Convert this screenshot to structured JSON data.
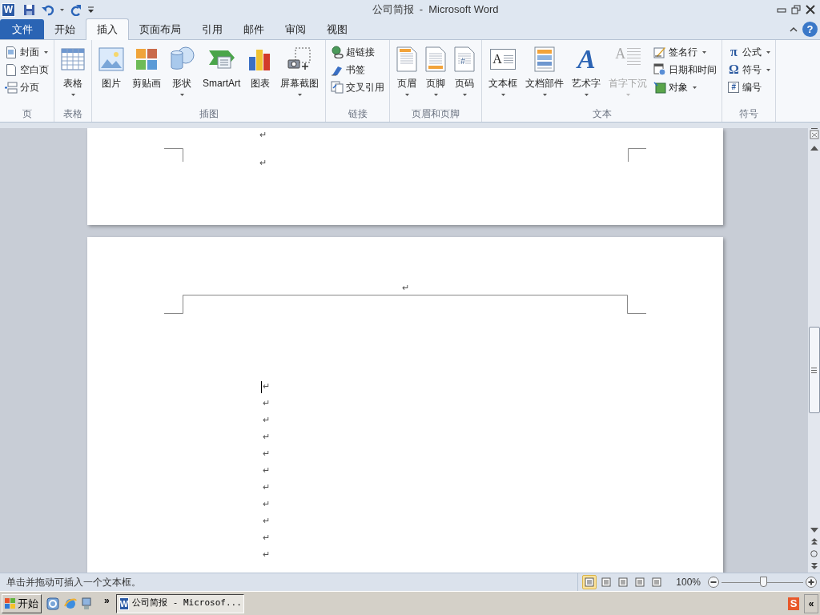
{
  "title_bar": {
    "logo": "W",
    "title": "公司简报  -  Microsoft Word"
  },
  "tabs": [
    {
      "label": "文件",
      "kind": "file",
      "selected": false
    },
    {
      "label": "开始",
      "kind": "tab",
      "selected": false
    },
    {
      "label": "插入",
      "kind": "tab",
      "selected": true
    },
    {
      "label": "页面布局",
      "kind": "tab",
      "selected": false
    },
    {
      "label": "引用",
      "kind": "tab",
      "selected": false
    },
    {
      "label": "邮件",
      "kind": "tab",
      "selected": false
    },
    {
      "label": "审阅",
      "kind": "tab",
      "selected": false
    },
    {
      "label": "视图",
      "kind": "tab",
      "selected": false
    }
  ],
  "help": "?",
  "ribbon": {
    "groups": [
      {
        "label": "页",
        "items": [
          {
            "label": "封面",
            "kind": "small",
            "dropdown": true,
            "disabled": false
          },
          {
            "label": "空白页",
            "kind": "small",
            "dropdown": false,
            "disabled": false
          },
          {
            "label": "分页",
            "kind": "small",
            "dropdown": false,
            "disabled": false
          }
        ]
      },
      {
        "label": "表格",
        "items": [
          {
            "label": "表格",
            "kind": "large",
            "dropdown": true,
            "disabled": false
          }
        ]
      },
      {
        "label": "插图",
        "items": [
          {
            "label": "图片",
            "kind": "large",
            "dropdown": false,
            "disabled": false
          },
          {
            "label": "剪贴画",
            "kind": "large",
            "dropdown": false,
            "disabled": false
          },
          {
            "label": "形状",
            "kind": "large",
            "dropdown": true,
            "disabled": false
          },
          {
            "label": "SmartArt",
            "kind": "large",
            "dropdown": false,
            "disabled": false
          },
          {
            "label": "图表",
            "kind": "large",
            "dropdown": false,
            "disabled": false
          },
          {
            "label": "屏幕截图",
            "kind": "large",
            "dropdown": true,
            "disabled": false
          }
        ]
      },
      {
        "label": "链接",
        "items": [
          {
            "label": "超链接",
            "kind": "small",
            "dropdown": false,
            "disabled": false
          },
          {
            "label": "书签",
            "kind": "small",
            "dropdown": false,
            "disabled": false
          },
          {
            "label": "交叉引用",
            "kind": "small",
            "dropdown": false,
            "disabled": false
          }
        ]
      },
      {
        "label": "页眉和页脚",
        "items": [
          {
            "label": "页眉",
            "kind": "large",
            "dropdown": true,
            "disabled": false
          },
          {
            "label": "页脚",
            "kind": "large",
            "dropdown": true,
            "disabled": false
          },
          {
            "label": "页码",
            "kind": "large",
            "dropdown": true,
            "disabled": false,
            "glyph": "#"
          }
        ]
      },
      {
        "label": "文本",
        "items": [
          {
            "label": "文本框",
            "kind": "large",
            "dropdown": true,
            "disabled": false,
            "glyph": "A"
          },
          {
            "label": "文档部件",
            "kind": "large",
            "dropdown": true,
            "disabled": false
          },
          {
            "label": "艺术字",
            "kind": "large",
            "dropdown": true,
            "disabled": false,
            "glyph": "A"
          },
          {
            "label": "首字下沉",
            "kind": "large",
            "dropdown": true,
            "disabled": true,
            "glyph": "A"
          },
          {
            "label": "签名行",
            "kind": "small",
            "dropdown": true,
            "disabled": false
          },
          {
            "label": "日期和时间",
            "kind": "small",
            "dropdown": false,
            "disabled": false
          },
          {
            "label": "对象",
            "kind": "small",
            "dropdown": true,
            "disabled": false
          }
        ]
      },
      {
        "label": "符号",
        "items": [
          {
            "label": "公式",
            "kind": "small",
            "dropdown": true,
            "disabled": false,
            "glyph": "π"
          },
          {
            "label": "符号",
            "kind": "small",
            "dropdown": true,
            "disabled": false,
            "glyph": "Ω"
          },
          {
            "label": "编号",
            "kind": "small",
            "dropdown": false,
            "disabled": false,
            "glyph": "#"
          }
        ]
      }
    ]
  },
  "document": {
    "page_1_marks": [
      "↵",
      "↵"
    ],
    "header_mark": "↵",
    "body_marks": [
      "↵",
      "↵",
      "↵",
      "↵",
      "↵",
      "↵",
      "↵",
      "↵",
      "↵",
      "↵",
      "↵"
    ]
  },
  "status_bar": {
    "text": "单击并拖动可插入一个文本框。",
    "views": [
      {
        "selected": true
      },
      {
        "selected": false
      },
      {
        "selected": false
      },
      {
        "selected": false
      },
      {
        "selected": false
      }
    ],
    "zoom": "100%",
    "zoom_level": {
      "level": 0.51
    }
  },
  "taskbar": {
    "start": "开始",
    "more": "»",
    "task": {
      "logo": "W",
      "label": "公司简报 - Microsof..."
    },
    "tray_logo": "S",
    "collapse": "«"
  }
}
